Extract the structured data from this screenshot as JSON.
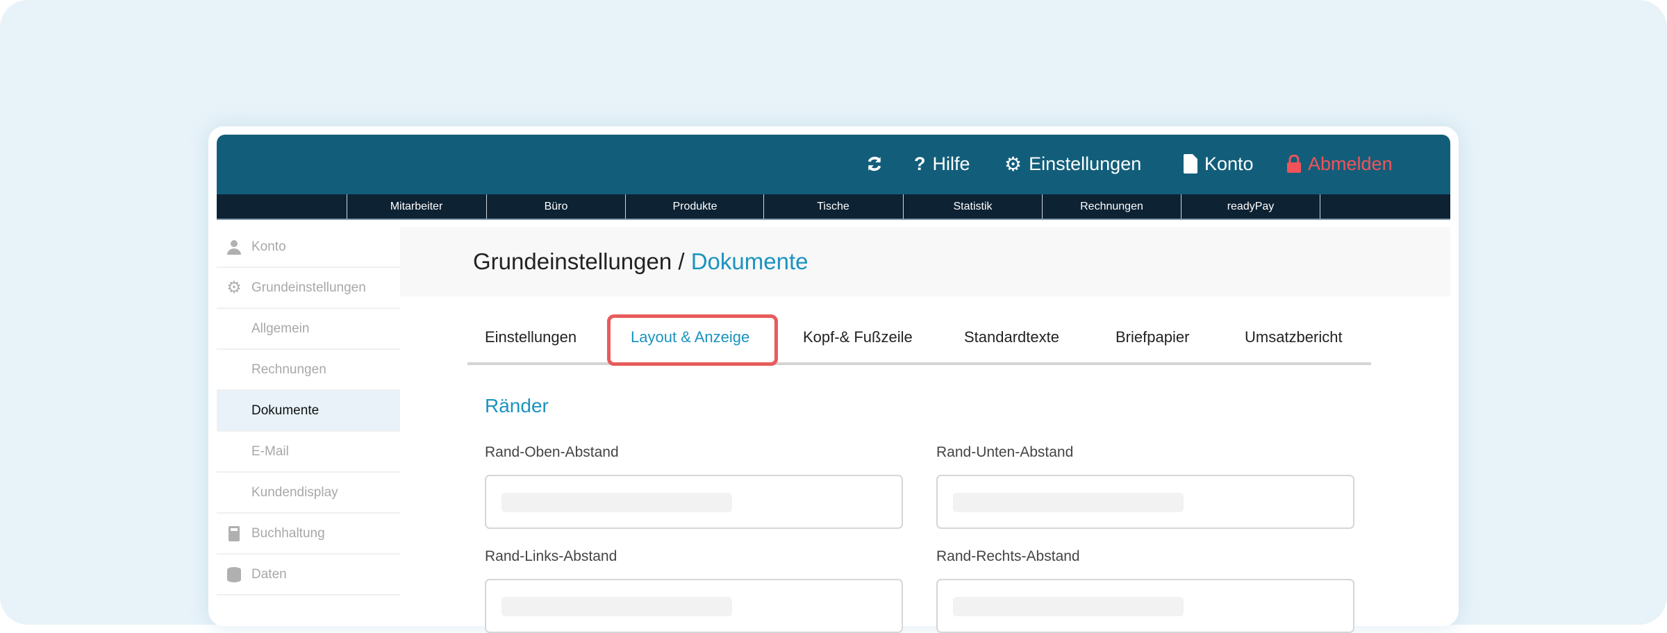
{
  "header": {
    "refresh_icon": "refresh-icon",
    "help": "Hilfe",
    "settings": "Einstellungen",
    "account": "Konto",
    "logout": "Abmelden",
    "logout_color": "#f0535a"
  },
  "nav": [
    "Mitarbeiter",
    "Büro",
    "Produkte",
    "Tische",
    "Statistik",
    "Rechnungen",
    "readyPay"
  ],
  "sidebar": [
    {
      "label": "Konto",
      "icon": "user-icon"
    },
    {
      "label": "Grundeinstellungen",
      "icon": "gear-icon"
    },
    {
      "label": "Allgemein"
    },
    {
      "label": "Rechnungen"
    },
    {
      "label": "Dokumente",
      "active": true
    },
    {
      "label": "E-Mail"
    },
    {
      "label": "Kundendisplay"
    },
    {
      "label": "Buchhaltung",
      "icon": "calculator-icon"
    },
    {
      "label": "Daten",
      "icon": "database-icon"
    }
  ],
  "page": {
    "title_main": "Grundeinstellungen / ",
    "title_accent": "Dokumente"
  },
  "tabs": [
    "Einstellungen",
    "Layout & Anzeige",
    "Kopf-& Fußzeile",
    "Standardtexte",
    "Briefpapier",
    "Umsatzbericht"
  ],
  "section": {
    "title": "Ränder",
    "fields": [
      "Rand-Oben-Abstand",
      "Rand-Unten-Abstand",
      "Rand-Links-Abstand",
      "Rand-Rechts-Abstand"
    ]
  }
}
